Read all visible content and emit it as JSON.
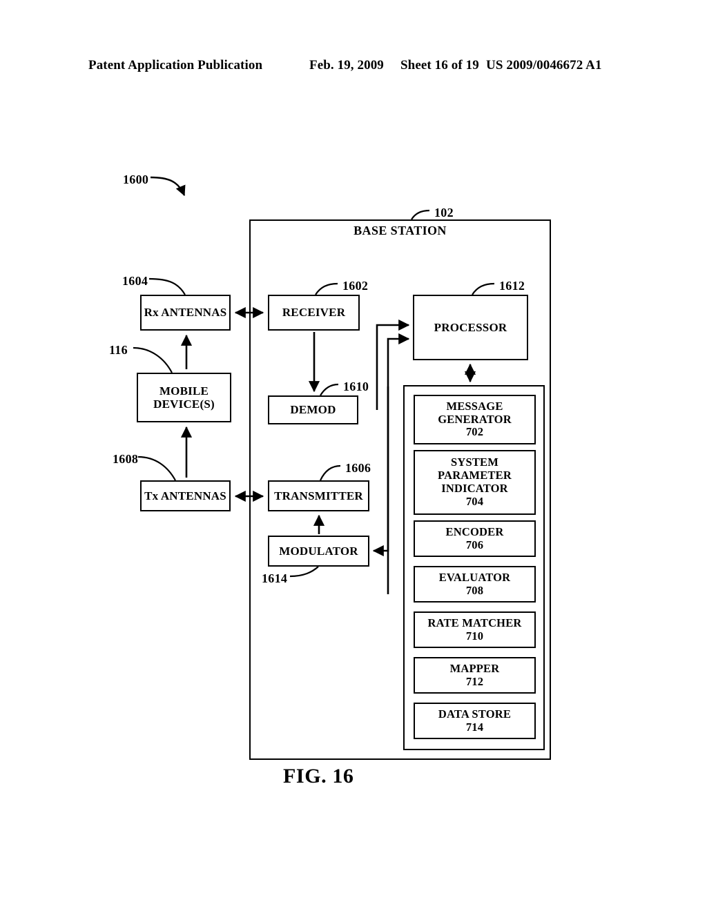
{
  "header": {
    "publication": "Patent Application Publication",
    "date": "Feb. 19, 2009",
    "sheet": "Sheet 16 of 19",
    "patent_number": "US 2009/0046672 A1"
  },
  "figure": {
    "caption": "FIG. 16",
    "system_ref": "1600",
    "enclosure": {
      "title": "BASE STATION",
      "ref": "102"
    },
    "blocks": [
      {
        "id": "rx-antennas",
        "label": "Rx ANTENNAS",
        "ref": "1604"
      },
      {
        "id": "receiver",
        "label": "RECEIVER",
        "ref": "1602"
      },
      {
        "id": "processor",
        "label": "PROCESSOR",
        "ref": "1612"
      },
      {
        "id": "mobile-device",
        "label": "MOBILE DEVICE(S)",
        "line1": "MOBILE",
        "line2": "DEVICE(S)",
        "ref": "116"
      },
      {
        "id": "demod",
        "label": "DEMOD",
        "ref": "1610"
      },
      {
        "id": "tx-antennas",
        "label": "Tx ANTENNAS",
        "ref": "1608"
      },
      {
        "id": "transmitter",
        "label": "TRANSMITTER",
        "ref": "1606"
      },
      {
        "id": "modulator",
        "label": "MODULATOR",
        "ref": "1614"
      }
    ],
    "components": [
      {
        "id": "message-generator",
        "line1": "MESSAGE",
        "line2": "GENERATOR",
        "line3": "",
        "ref": "702"
      },
      {
        "id": "system-parameter-indicator",
        "line1": "SYSTEM",
        "line2": "PARAMETER",
        "line3": "INDICATOR",
        "ref": "704"
      },
      {
        "id": "encoder",
        "line1": "ENCODER",
        "line2": "",
        "line3": "",
        "ref": "706"
      },
      {
        "id": "evaluator",
        "line1": "EVALUATOR",
        "line2": "",
        "line3": "",
        "ref": "708"
      },
      {
        "id": "rate-matcher",
        "line1": "RATE MATCHER",
        "line2": "",
        "line3": "",
        "ref": "710"
      },
      {
        "id": "mapper",
        "line1": "MAPPER",
        "line2": "",
        "line3": "",
        "ref": "712"
      },
      {
        "id": "data-store",
        "line1": "DATA STORE",
        "line2": "",
        "line3": "",
        "ref": "714"
      }
    ]
  },
  "colors": {
    "ink": "#000000",
    "paper": "#ffffff"
  }
}
